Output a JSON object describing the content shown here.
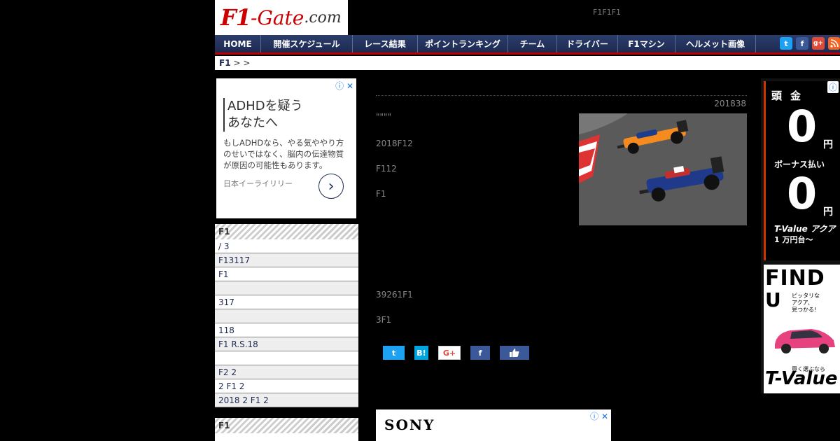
{
  "header": {
    "logo_f1": "F1",
    "logo_gate": "-Gate",
    "logo_com": ".com",
    "tagline": "F1F1F1"
  },
  "nav": {
    "items": [
      "HOME",
      "開催スケジュール",
      "レース結果",
      "ポイントランキング",
      "チーム",
      "ドライバー",
      "F1マシン",
      "ヘルメット画像"
    ],
    "social": [
      "twitter-icon",
      "facebook-icon",
      "google-plus-icon",
      "rss-icon"
    ]
  },
  "breadcrumb": {
    "root": "F1",
    "rest": "> >"
  },
  "ad_left": {
    "choices": "ⓘ ✕",
    "headline_1": "ADHDを疑う",
    "headline_2": "あなたへ",
    "body": "もしADHDなら、やる気ややり方のせいではなく、脳内の伝達物質が原因の可能性もあります。",
    "sponsor": "日本イーライリリー",
    "arrow": "›"
  },
  "sidebar1": {
    "heading": "F1",
    "rows": [
      " / 3",
      "F13117",
      " F1",
      "",
      "317",
      "",
      "118",
      "F1 R.S.18",
      "",
      "F2 2",
      "2 F1 2",
      "2018 2 F1 2"
    ]
  },
  "sidebar2": {
    "heading": "F1"
  },
  "article": {
    "date": "201838",
    "quote_marks": "\"\"\"\"",
    "paragraphs": [
      "2018F12",
      "F112",
      "F1",
      "39261F1",
      "3F1"
    ]
  },
  "share": {
    "twitter": "t",
    "hatena": "B!",
    "googleplus": "G+",
    "facebook": "f",
    "like": "👍"
  },
  "ad_bottom": {
    "brand": "SONY",
    "choices": "ⓘ ✕"
  },
  "ad_right": {
    "choices": "ⓘ",
    "t1": "頭金",
    "zero": "0",
    "yen": "円",
    "t2": "ボーナス払い",
    "t3": "T-Value アクア",
    "t4": "1 万円台〜",
    "find": "FIND",
    "u": "U",
    "side_txt": "ピッタリな\nアクア、\n見つかる!",
    "t5": "買く選ぶなら",
    "t6": "T-Value"
  },
  "colors": {
    "nav_bg": "#1d2a52",
    "nav_accent": "#bb0000",
    "twitter": "#1da1f2",
    "facebook": "#3b5998",
    "googleplus": "#dd4b39",
    "rss": "#f26522",
    "hatena": "#00a4de",
    "like": "#3b5998"
  }
}
